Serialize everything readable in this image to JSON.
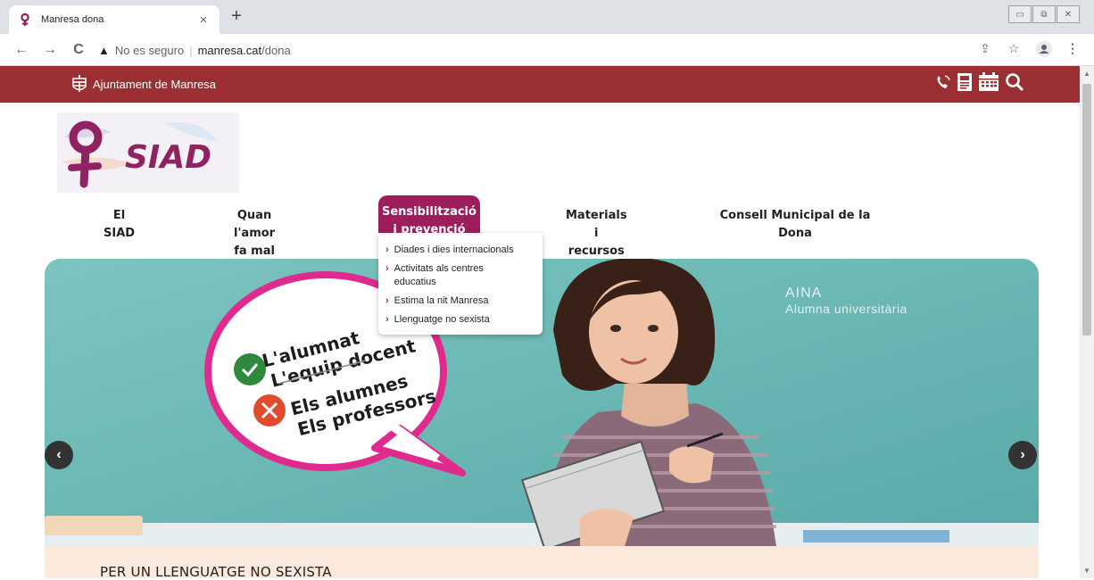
{
  "browser": {
    "tab_title": "Manresa dona",
    "tab_close": "×",
    "new_tab": "+",
    "insecure_label": "No es seguro",
    "url_host": "manresa.cat",
    "url_path": "/dona",
    "nav_back": "←",
    "nav_forward": "→",
    "nav_reload": "C",
    "warning_icon": "warning-triangle-icon"
  },
  "site_header": {
    "org_name": "Ajuntament de Manresa",
    "icons": [
      "phone-icon",
      "document-icon",
      "calendar-icon",
      "search-icon"
    ],
    "bar_color": "#9b2f33"
  },
  "logo": {
    "text": "SIAD"
  },
  "nav": {
    "items": [
      {
        "label": "El SIAD"
      },
      {
        "label": "Quan l'amor fa mal"
      },
      {
        "label": "Sensibilització i prevenció"
      },
      {
        "label": "Materials i recursos"
      },
      {
        "label_line1": "Consell Municipal de la",
        "label_line2": "Dona"
      }
    ],
    "active_color": "#9c1f5c"
  },
  "dropdown": {
    "items": [
      {
        "label": "Diades i dies internacionals"
      },
      {
        "label_line1": "Activitats als centres",
        "label_line2": "educatius"
      },
      {
        "label": "Estima la nit Manresa"
      },
      {
        "label": "Llenguatge no sexista"
      }
    ]
  },
  "hero": {
    "person_name": "AINA",
    "person_role": "Alumna universitària",
    "bubble_line1": "L'alumnat",
    "bubble_line2": "L'equip docent",
    "bubble_line3": "Els alumnes",
    "bubble_line4": "Els professors",
    "prev": "‹",
    "next": "›"
  },
  "section": {
    "title": "PER UN LLENGUATGE NO SEXISTA"
  }
}
